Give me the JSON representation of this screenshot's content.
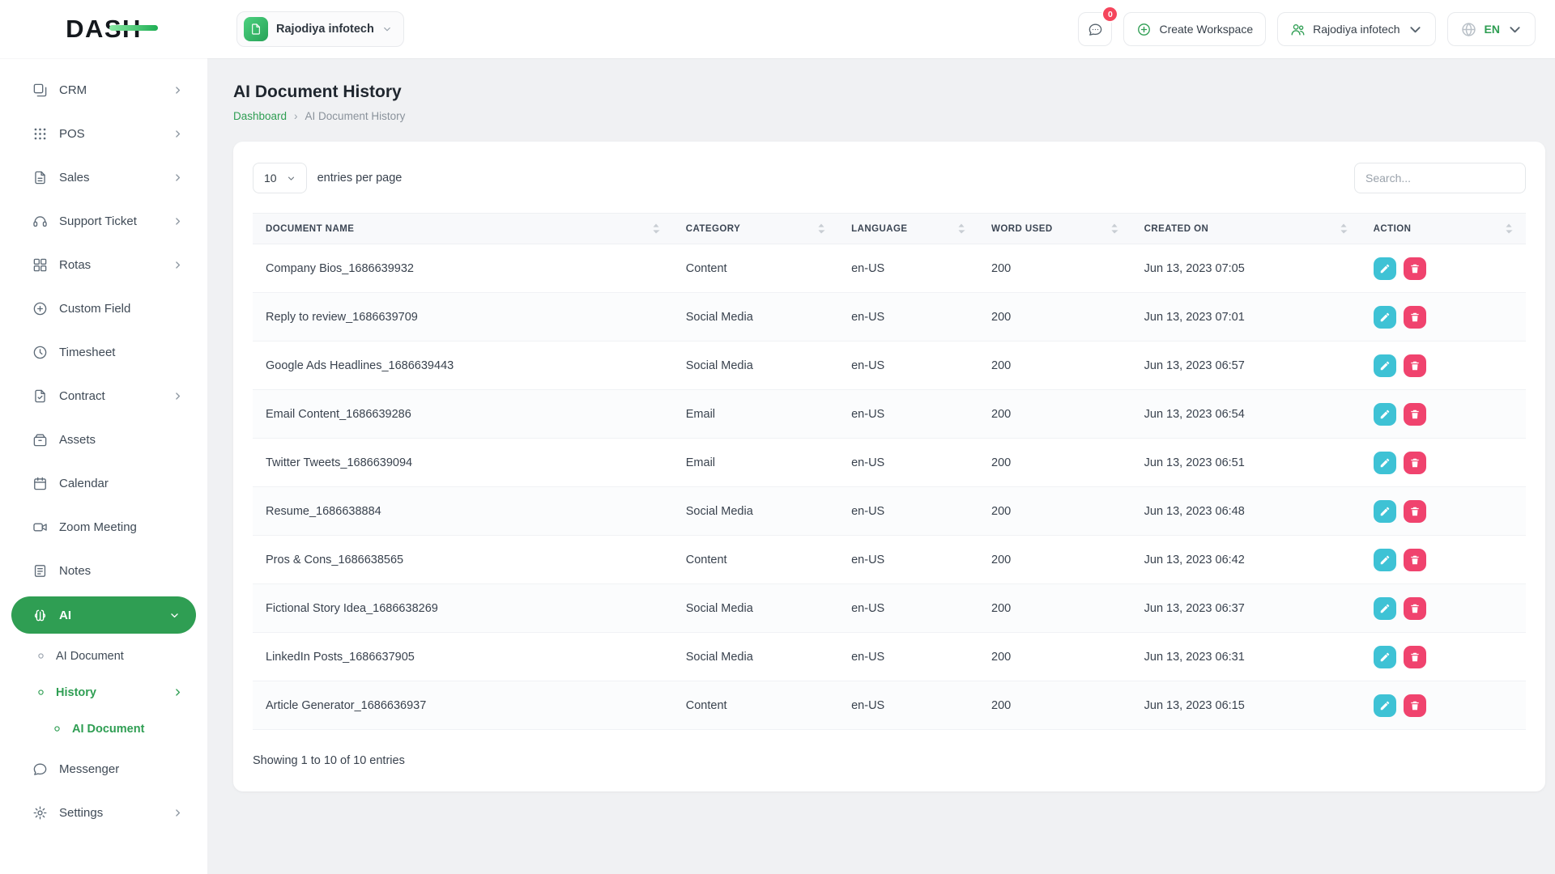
{
  "app": {
    "logo_text": "DASH"
  },
  "header": {
    "workspace_selector": {
      "label": "Rajodiya infotech",
      "icon": "doc-icon"
    },
    "messages": {
      "badge": "0",
      "icon": "chat-icon"
    },
    "create_workspace": {
      "label": "Create Workspace",
      "icon": "plus-circle-icon"
    },
    "account_selector": {
      "label": "Rajodiya infotech",
      "icon": "users-icon"
    },
    "language_selector": {
      "label": "EN",
      "icon": "globe-icon"
    }
  },
  "sidebar": {
    "items": [
      {
        "label": "CRM",
        "icon": "crm-icon",
        "level": 1,
        "chevron": "right"
      },
      {
        "label": "POS",
        "icon": "pos-icon",
        "level": 1,
        "chevron": "right"
      },
      {
        "label": "Sales",
        "icon": "sales-icon",
        "level": 1,
        "chevron": "right"
      },
      {
        "label": "Support Ticket",
        "icon": "support-ticket-icon",
        "level": 1,
        "chevron": "right"
      },
      {
        "label": "Rotas",
        "icon": "rotas-icon",
        "level": 1,
        "chevron": "right"
      },
      {
        "label": "Custom Field",
        "icon": "custom-field-icon",
        "level": 1
      },
      {
        "label": "Timesheet",
        "icon": "timesheet-icon",
        "level": 1
      },
      {
        "label": "Contract",
        "icon": "contract-icon",
        "level": 1,
        "chevron": "right"
      },
      {
        "label": "Assets",
        "icon": "assets-icon",
        "level": 1
      },
      {
        "label": "Calendar",
        "icon": "calendar-icon",
        "level": 1
      },
      {
        "label": "Zoom Meeting",
        "icon": "zoom-meeting-icon",
        "level": 1
      },
      {
        "label": "Notes",
        "icon": "notes-icon",
        "level": 1
      },
      {
        "label": "AI",
        "icon": "ai-icon",
        "level": 1,
        "chevron": "down",
        "active": true
      },
      {
        "label": "AI Document",
        "icon": "dot-icon",
        "level": 2
      },
      {
        "label": "History",
        "icon": "dot-icon",
        "level": 2,
        "chevron": "right",
        "active": true
      },
      {
        "label": "AI Document",
        "icon": "dot-icon",
        "level": 3,
        "active": true
      },
      {
        "label": "Messenger",
        "icon": "messenger-icon",
        "level": 1
      },
      {
        "label": "Settings",
        "icon": "settings-icon",
        "level": 1,
        "chevron": "right"
      }
    ]
  },
  "page": {
    "title": "AI Document History",
    "breadcrumb": [
      {
        "label": "Dashboard",
        "link": true
      },
      {
        "label": "AI Document History",
        "link": false
      }
    ]
  },
  "controls": {
    "page_size": "10",
    "entries_label": "entries per page",
    "search_placeholder": "Search..."
  },
  "table": {
    "columns": [
      "DOCUMENT NAME",
      "CATEGORY",
      "LANGUAGE",
      "WORD USED",
      "CREATED ON",
      "ACTION"
    ],
    "rows": [
      {
        "name": "Company Bios_1686639932",
        "category": "Content",
        "language": "en-US",
        "word_used": "200",
        "created_on": "Jun 13, 2023 07:05"
      },
      {
        "name": "Reply to review_1686639709",
        "category": "Social Media",
        "language": "en-US",
        "word_used": "200",
        "created_on": "Jun 13, 2023 07:01"
      },
      {
        "name": "Google Ads Headlines_1686639443",
        "category": "Social Media",
        "language": "en-US",
        "word_used": "200",
        "created_on": "Jun 13, 2023 06:57"
      },
      {
        "name": "Email Content_1686639286",
        "category": "Email",
        "language": "en-US",
        "word_used": "200",
        "created_on": "Jun 13, 2023 06:54"
      },
      {
        "name": "Twitter Tweets_1686639094",
        "category": "Email",
        "language": "en-US",
        "word_used": "200",
        "created_on": "Jun 13, 2023 06:51"
      },
      {
        "name": "Resume_1686638884",
        "category": "Social Media",
        "language": "en-US",
        "word_used": "200",
        "created_on": "Jun 13, 2023 06:48"
      },
      {
        "name": "Pros & Cons_1686638565",
        "category": "Content",
        "language": "en-US",
        "word_used": "200",
        "created_on": "Jun 13, 2023 06:42"
      },
      {
        "name": "Fictional Story Idea_1686638269",
        "category": "Social Media",
        "language": "en-US",
        "word_used": "200",
        "created_on": "Jun 13, 2023 06:37"
      },
      {
        "name": "LinkedIn Posts_1686637905",
        "category": "Social Media",
        "language": "en-US",
        "word_used": "200",
        "created_on": "Jun 13, 2023 06:31"
      },
      {
        "name": "Article Generator_1686636937",
        "category": "Content",
        "language": "en-US",
        "word_used": "200",
        "created_on": "Jun 13, 2023 06:15"
      }
    ],
    "row_actions": [
      {
        "name": "edit",
        "icon": "pencil-icon"
      },
      {
        "name": "delete",
        "icon": "trash-icon"
      }
    ],
    "footer_text": "Showing 1 to 10 of 10 entries"
  },
  "colors": {
    "primary": "#2f9e53",
    "edit": "#3ec2d5",
    "delete": "#f0436e",
    "badge": "#f5455c"
  }
}
